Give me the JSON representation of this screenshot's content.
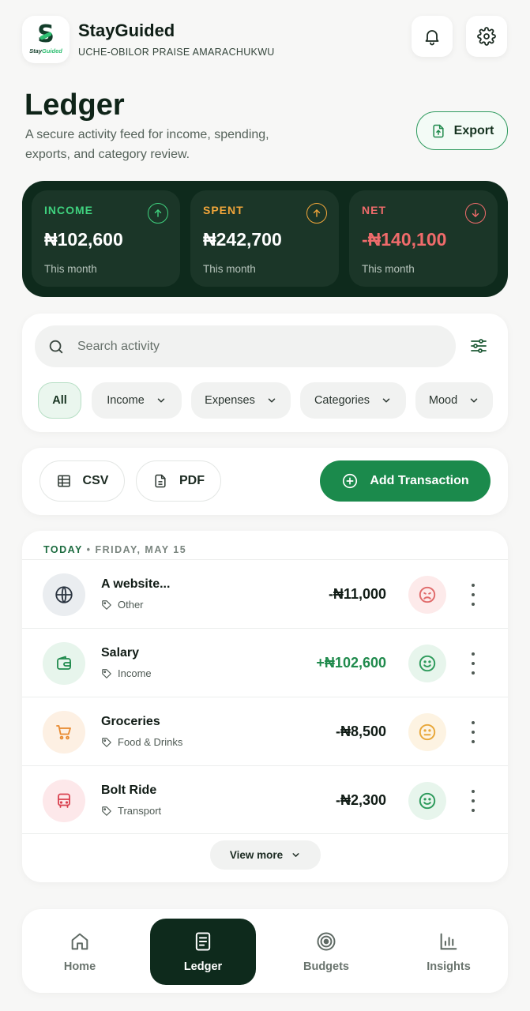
{
  "app": {
    "logo_letter": "S",
    "logo_text_a": "Stay",
    "logo_text_b": "Guided",
    "name": "StayGuided",
    "user": "UCHE-OBILOR PRAISE AMARACHUKWU"
  },
  "header": {
    "icons": [
      "bell-icon",
      "gear-icon"
    ]
  },
  "page": {
    "title": "Ledger",
    "subtitle": "A secure activity feed for income, spending, exports, and category review.",
    "export_label": "Export"
  },
  "summary": [
    {
      "label": "INCOME",
      "value": "₦102,600",
      "foot": "This month",
      "color": "#3fd17e",
      "icon": "arrow-up-icon"
    },
    {
      "label": "SPENT",
      "value": "₦242,700",
      "foot": "This month",
      "color": "#f0a53a",
      "icon": "arrow-up-icon"
    },
    {
      "label": "NET",
      "value": "-₦140,100",
      "foot": "This month",
      "color": "#ef6b6b",
      "icon": "arrow-down-icon"
    }
  ],
  "search": {
    "placeholder": "Search activity"
  },
  "filters": [
    {
      "label": "All",
      "active": true
    },
    {
      "label": "Income",
      "active": false
    },
    {
      "label": "Expenses",
      "active": false
    },
    {
      "label": "Categories",
      "active": false
    },
    {
      "label": "Mood",
      "active": false
    }
  ],
  "actions": {
    "csv_label": "CSV",
    "pdf_label": "PDF",
    "add_label": "Add Transaction"
  },
  "ledger": {
    "date_today": "TODAY",
    "date_sep": " • ",
    "date_rest": "FRIDAY, MAY 15",
    "rows": [
      {
        "title": "A website...",
        "tag": "Other",
        "amount": "-₦11,000",
        "positive": false,
        "icon": "globe-icon",
        "mood": "sad"
      },
      {
        "title": "Salary",
        "tag": "Income",
        "amount": "+₦102,600",
        "positive": true,
        "icon": "wallet-icon",
        "mood": "happy"
      },
      {
        "title": "Groceries",
        "tag": "Food & Drinks",
        "amount": "-₦8,500",
        "positive": false,
        "icon": "cart-icon",
        "mood": "neutral"
      },
      {
        "title": "Bolt Ride",
        "tag": "Transport",
        "amount": "-₦2,300",
        "positive": false,
        "icon": "bus-icon",
        "mood": "happy"
      }
    ],
    "view_more": "View more"
  },
  "nav": [
    {
      "label": "Home",
      "icon": "home-icon",
      "active": false
    },
    {
      "label": "Ledger",
      "icon": "ledger-icon",
      "active": true
    },
    {
      "label": "Budgets",
      "icon": "target-icon",
      "active": false
    },
    {
      "label": "Insights",
      "icon": "bar-chart-icon",
      "active": false
    }
  ]
}
